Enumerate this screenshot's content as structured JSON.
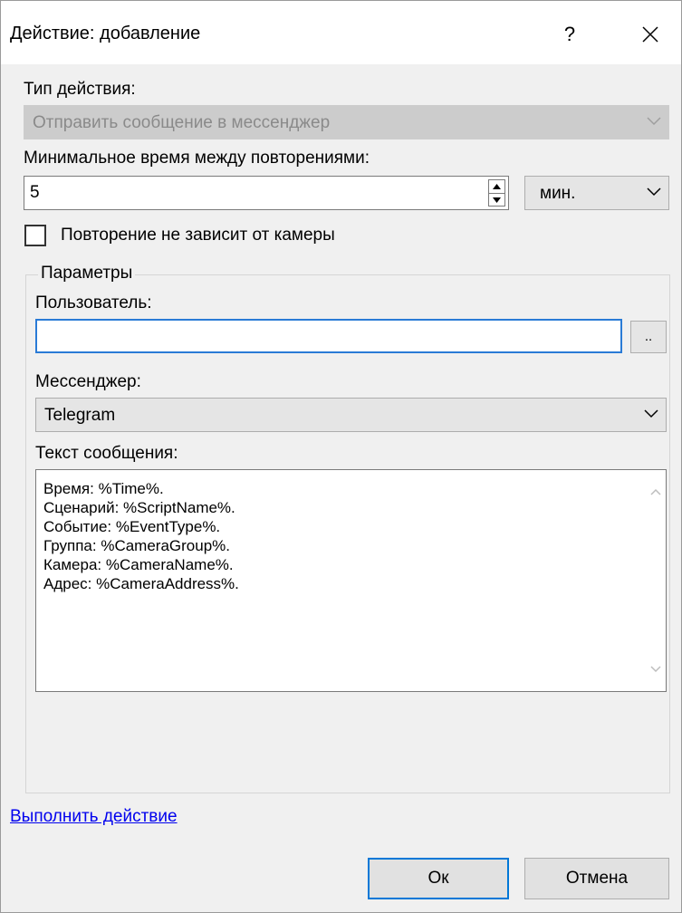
{
  "window": {
    "title": "Действие: добавление",
    "help_label": "?"
  },
  "action_type": {
    "label": "Тип действия:",
    "value": "Отправить сообщение в мессенджер"
  },
  "min_interval": {
    "label": "Минимальное время между повторениями:",
    "value": "5",
    "unit": "мин."
  },
  "repeat_checkbox": {
    "label": "Повторение не зависит от камеры",
    "checked": false
  },
  "params": {
    "legend": "Параметры",
    "user_label": "Пользователь:",
    "user_value": "",
    "browse_label": "..",
    "messenger_label": "Мессенджер:",
    "messenger_value": "Telegram",
    "message_label": "Текст сообщения:",
    "message_text": "Время: %Time%.\nСценарий: %ScriptName%.\nСобытие: %EventType%.\nГруппа: %CameraGroup%.\nКамера: %CameraName%.\nАдрес: %CameraAddress%."
  },
  "run_action_link": "Выполнить действие",
  "buttons": {
    "ok": "Ок",
    "cancel": "Отмена"
  },
  "colors": {
    "accent": "#0078d7",
    "link": "#0000ee",
    "window_bg": "#f0f0f0"
  }
}
